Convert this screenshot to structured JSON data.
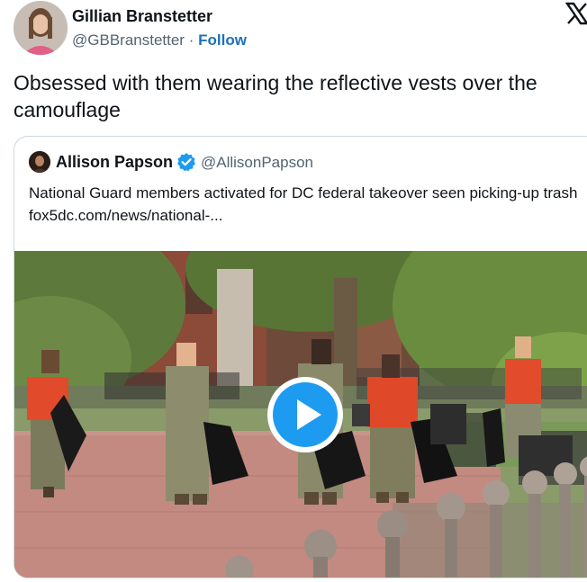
{
  "tweet": {
    "author_name": "Gillian Branstetter",
    "author_handle": "@GBBranstetter",
    "separator": "·",
    "follow_label": "Follow",
    "text": "Obsessed with them wearing the reflective vests over the camouflage"
  },
  "quote": {
    "author_name": "Allison Papson",
    "author_handle": "@AllisonPapson",
    "verified": true,
    "text": "National Guard members activated for DC federal takeover seen picking-up trash fox5dc.com/news/national-..."
  },
  "media": {
    "type": "video",
    "play_icon": "play-icon"
  },
  "colors": {
    "link": "#1d71b8",
    "verified": "#1d9bf0",
    "play_button": "#1d9bf0",
    "secondary_text": "#536471",
    "border": "#cfd9de"
  },
  "icons": {
    "brand": "x-logo-icon",
    "verified": "verified-badge-icon"
  }
}
